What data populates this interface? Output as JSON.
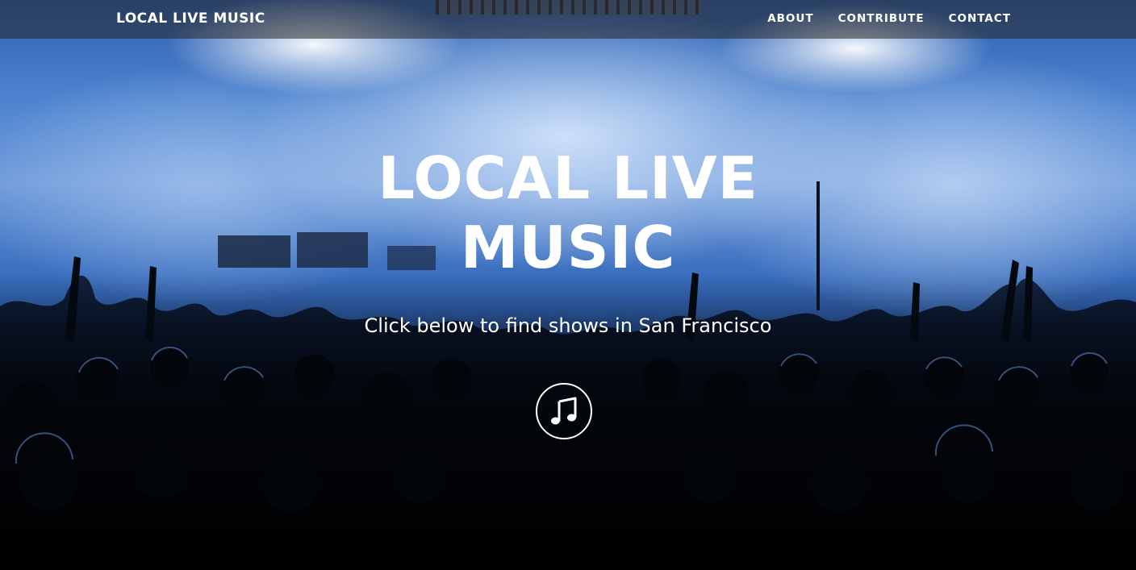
{
  "navbar": {
    "brand": "LOCAL LIVE MUSIC",
    "links": [
      "ABOUT",
      "CONTRIBUTE",
      "CONTACT"
    ]
  },
  "hero": {
    "title_line1": "LOCAL LIVE",
    "title_line2": "MUSIC",
    "subtitle": "Click below to find shows in San Francisco",
    "button_icon": "music-note-icon"
  },
  "colors": {
    "text": "#ffffff",
    "navbar_bg": "#282828",
    "hero_blue": "#4f85d0"
  }
}
